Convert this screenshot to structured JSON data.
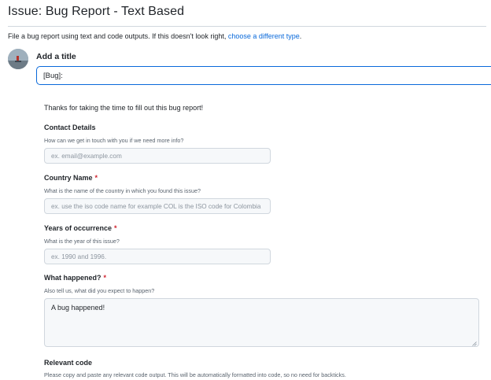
{
  "page": {
    "title": "Issue: Bug Report - Text Based",
    "intro_text": "File a bug report using text and code outputs. If this doesn't look right, ",
    "intro_link": "choose a different type",
    "intro_end": "."
  },
  "title_field": {
    "label": "Add a title",
    "value": "[Bug]: "
  },
  "form": {
    "thanks": "Thanks for taking the time to fill out this bug report!",
    "contact": {
      "label": "Contact Details",
      "description": "How can we get in touch with you if we need more info?",
      "placeholder": "ex. email@example.com"
    },
    "country": {
      "label": "Country Name",
      "required_mark": "*",
      "description": "What is the name of the country in which you found this issue?",
      "placeholder": "ex. use the iso code name for example COL is the ISO code for Colombia"
    },
    "years": {
      "label": "Years of occurrence",
      "required_mark": "*",
      "description": "What is the year of this issue?",
      "placeholder": "ex. 1990 and 1996."
    },
    "what_happened": {
      "label": "What happened?",
      "required_mark": "*",
      "description": "Also tell us, what did you expect to happen?",
      "value": "A bug happened!"
    },
    "relevant_code": {
      "label": "Relevant code",
      "description": "Please copy and paste any relevant code output. This will be automatically formatted into code, so no need for backticks."
    }
  },
  "colors": {
    "accent": "#0969da",
    "required": "#cf222e",
    "border": "#d0d7de",
    "input_bg": "#f6f8fa"
  }
}
